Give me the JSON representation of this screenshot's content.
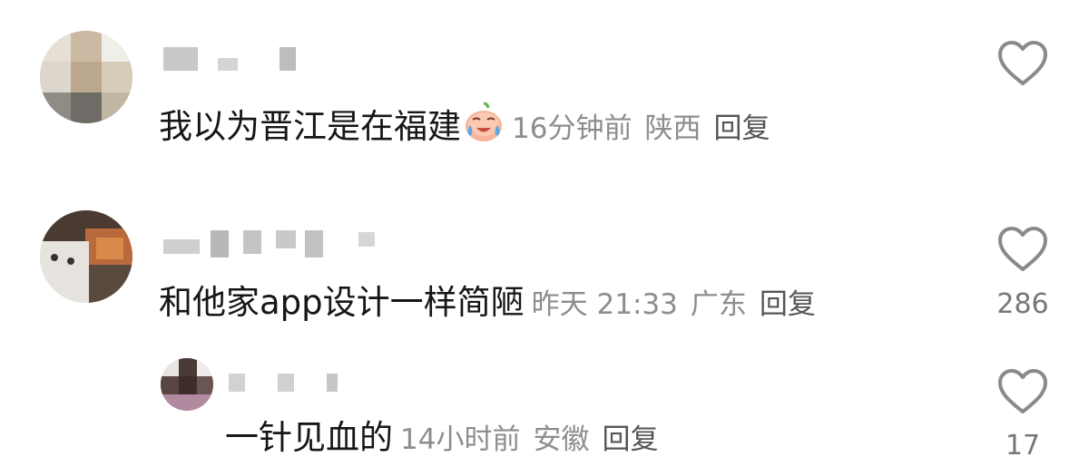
{
  "comments": [
    {
      "content": "我以为晋江是在福建",
      "emoji": "crying-face-emoji",
      "time": "16分钟前",
      "location": "陕西",
      "reply_label": "回复",
      "like_count": ""
    },
    {
      "content": "和他家app设计一样简陋",
      "time": "昨天 21:33",
      "location": "广东",
      "reply_label": "回复",
      "like_count": "286"
    },
    {
      "content": "一针见血的",
      "time": "14小时前",
      "location": "安徽",
      "reply_label": "回复",
      "like_count": "17"
    }
  ],
  "icons": {
    "like": "heart-outline-icon"
  },
  "colors": {
    "text": "#161616",
    "meta": "#8d8d8d",
    "reply": "#555555",
    "icon": "#8a8a8a"
  }
}
